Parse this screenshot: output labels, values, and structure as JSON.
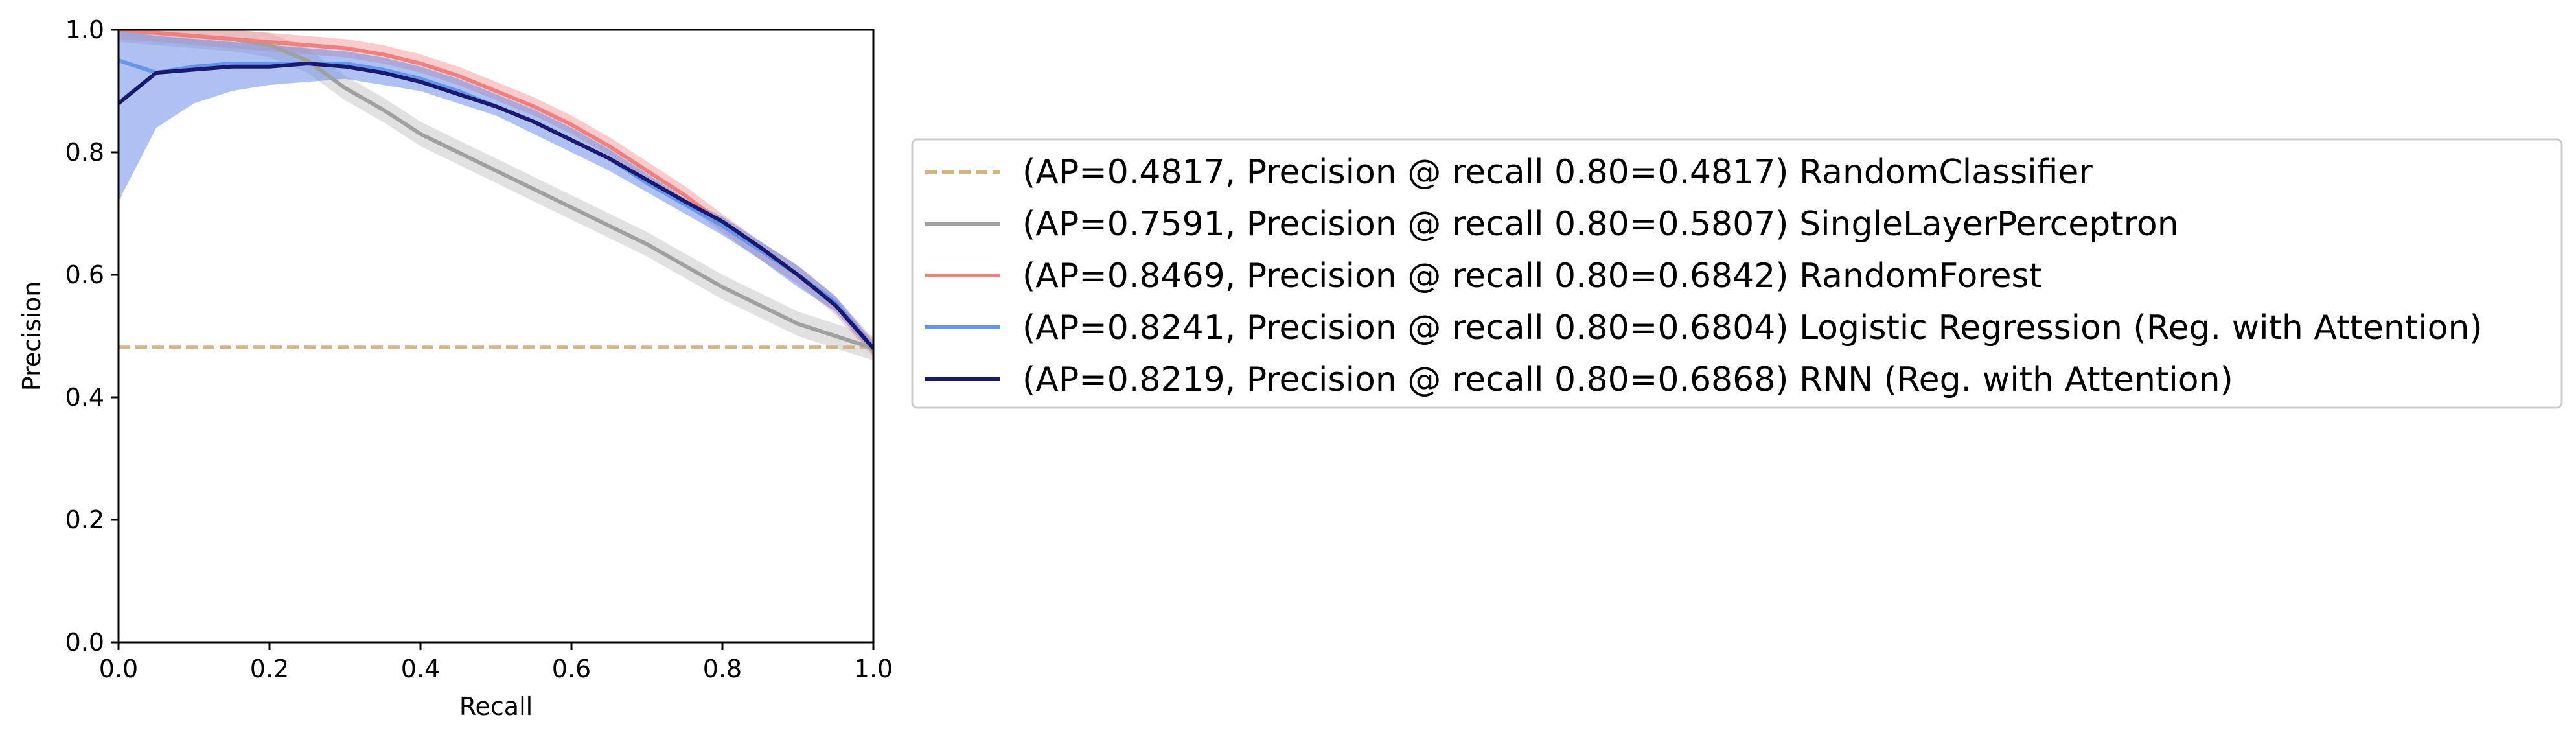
{
  "chart_data": {
    "type": "line",
    "xlabel": "Recall",
    "ylabel": "Precision",
    "xlim": [
      0.0,
      1.0
    ],
    "ylim": [
      0.0,
      1.0
    ],
    "x_ticks": [
      {
        "value": 0.0,
        "label": "0.0"
      },
      {
        "value": 0.2,
        "label": "0.2"
      },
      {
        "value": 0.4,
        "label": "0.4"
      },
      {
        "value": 0.6,
        "label": "0.6"
      },
      {
        "value": 0.8,
        "label": "0.8"
      },
      {
        "value": 1.0,
        "label": "1.0"
      }
    ],
    "y_ticks": [
      {
        "value": 0.0,
        "label": "0.0"
      },
      {
        "value": 0.2,
        "label": "0.2"
      },
      {
        "value": 0.4,
        "label": "0.4"
      },
      {
        "value": 0.6,
        "label": "0.6"
      },
      {
        "value": 0.8,
        "label": "0.8"
      },
      {
        "value": 1.0,
        "label": "1.0"
      }
    ],
    "grid": false,
    "legend_placement": "outside right",
    "series": [
      {
        "name": "(AP=0.4817, Precision @ recall 0.80=0.4817) RandomClassifier",
        "color": "#d4b483",
        "dashed": true,
        "x": [
          0.0,
          1.0
        ],
        "y": [
          0.4817,
          0.4817
        ]
      },
      {
        "name": "(AP=0.7591, Precision @ recall 0.80=0.5807) SingleLayerPerceptron",
        "color": "#a0a0a0",
        "band_color": "#c8c8c8",
        "band_width": 0.02,
        "x": [
          0.0,
          0.05,
          0.1,
          0.15,
          0.2,
          0.25,
          0.3,
          0.35,
          0.4,
          0.45,
          0.5,
          0.55,
          0.6,
          0.65,
          0.7,
          0.75,
          0.8,
          0.85,
          0.9,
          0.95,
          1.0
        ],
        "y": [
          1.0,
          0.995,
          0.99,
          0.985,
          0.975,
          0.95,
          0.905,
          0.87,
          0.83,
          0.8,
          0.77,
          0.74,
          0.71,
          0.68,
          0.65,
          0.615,
          0.58,
          0.55,
          0.52,
          0.5,
          0.48
        ]
      },
      {
        "name": "(AP=0.8469, Precision @ recall 0.80=0.6842) RandomForest",
        "color": "#f08080",
        "band_color": "#f4a0a0",
        "band_width": 0.015,
        "x": [
          0.0,
          0.05,
          0.1,
          0.15,
          0.2,
          0.25,
          0.3,
          0.35,
          0.4,
          0.45,
          0.5,
          0.55,
          0.6,
          0.65,
          0.7,
          0.75,
          0.8,
          0.85,
          0.9,
          0.95,
          1.0
        ],
        "y": [
          1.0,
          0.995,
          0.99,
          0.985,
          0.98,
          0.975,
          0.97,
          0.96,
          0.945,
          0.925,
          0.9,
          0.875,
          0.845,
          0.81,
          0.77,
          0.73,
          0.684,
          0.64,
          0.6,
          0.55,
          0.48
        ]
      },
      {
        "name": "(AP=0.8241, Precision @ recall 0.80=0.6804) Logistic Regression (Reg. with Attention)",
        "color": "#6495ed",
        "band_color": "#6b8ee8",
        "band_upper": [
          1.0,
          0.99,
          0.985,
          0.98,
          0.975,
          0.97,
          0.965,
          0.955,
          0.94,
          0.92,
          0.895,
          0.87,
          0.84,
          0.805,
          0.765,
          0.725,
          0.695,
          0.655,
          0.615,
          0.565,
          0.49
        ],
        "band_lower": [
          0.72,
          0.84,
          0.88,
          0.9,
          0.91,
          0.915,
          0.92,
          0.91,
          0.9,
          0.88,
          0.86,
          0.83,
          0.8,
          0.77,
          0.735,
          0.7,
          0.665,
          0.625,
          0.58,
          0.54,
          0.47
        ],
        "x": [
          0.0,
          0.05,
          0.1,
          0.15,
          0.2,
          0.25,
          0.3,
          0.35,
          0.4,
          0.45,
          0.5,
          0.55,
          0.6,
          0.65,
          0.7,
          0.75,
          0.8,
          0.85,
          0.9,
          0.95,
          1.0
        ],
        "y": [
          0.95,
          0.93,
          0.94,
          0.945,
          0.945,
          0.945,
          0.945,
          0.935,
          0.92,
          0.9,
          0.875,
          0.85,
          0.82,
          0.79,
          0.75,
          0.715,
          0.68,
          0.64,
          0.6,
          0.555,
          0.48
        ]
      },
      {
        "name": "(AP=0.8219, Precision @ recall 0.80=0.6868) RNN (Reg. with Attention)",
        "color": "#191970",
        "x": [
          0.0,
          0.02,
          0.05,
          0.1,
          0.15,
          0.2,
          0.25,
          0.3,
          0.35,
          0.4,
          0.45,
          0.5,
          0.55,
          0.6,
          0.65,
          0.7,
          0.75,
          0.8,
          0.85,
          0.9,
          0.95,
          1.0
        ],
        "y": [
          0.88,
          0.9,
          0.93,
          0.935,
          0.94,
          0.94,
          0.945,
          0.94,
          0.93,
          0.915,
          0.895,
          0.875,
          0.85,
          0.82,
          0.79,
          0.755,
          0.72,
          0.687,
          0.645,
          0.6,
          0.55,
          0.48
        ]
      }
    ]
  }
}
